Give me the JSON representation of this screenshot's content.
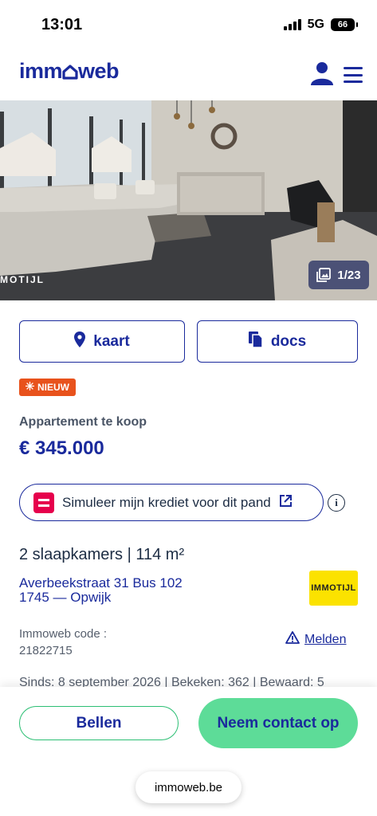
{
  "status": {
    "time": "13:01",
    "network": "5G",
    "battery": "66"
  },
  "header": {
    "logo_pre": "imm",
    "logo_post": "web"
  },
  "photo": {
    "watermark": "MOTIJL",
    "counter": "1/23"
  },
  "actions": {
    "map_label": "kaart",
    "docs_label": "docs"
  },
  "listing": {
    "badge": "NIEUW",
    "type": "Appartement te koop",
    "price": "€ 345.000",
    "credit_text": "Simuleer mijn krediet voor dit pand",
    "info": "i",
    "summary": "2 slaapkamers | 114 m²",
    "address_line1": "Averbeekstraat 31 Bus 102",
    "address_line2": "1745 — Opwijk",
    "agency": "IMMOTIJL",
    "code_label": "Immoweb code :",
    "code_value": "21822715",
    "report_label": "Melden",
    "meta": "Sinds: 8 september 2026 | Bekeken: 362 | Bewaard: 5"
  },
  "bottom": {
    "call_label": "Bellen",
    "contact_label": "Neem contact op",
    "url": "immoweb.be"
  },
  "colors": {
    "brand_blue": "#1a2a9c",
    "green": "#5ddc98",
    "badge_orange": "#e8521c",
    "bank_red": "#e6004c",
    "agency_yellow": "#fbe200"
  },
  "icons": [
    "wifi-less-signal-icon",
    "user-icon",
    "hamburger-menu-icon",
    "gallery-icon",
    "map-pin-icon",
    "documents-icon",
    "sparkle-icon",
    "external-link-icon",
    "info-icon",
    "warning-icon"
  ]
}
